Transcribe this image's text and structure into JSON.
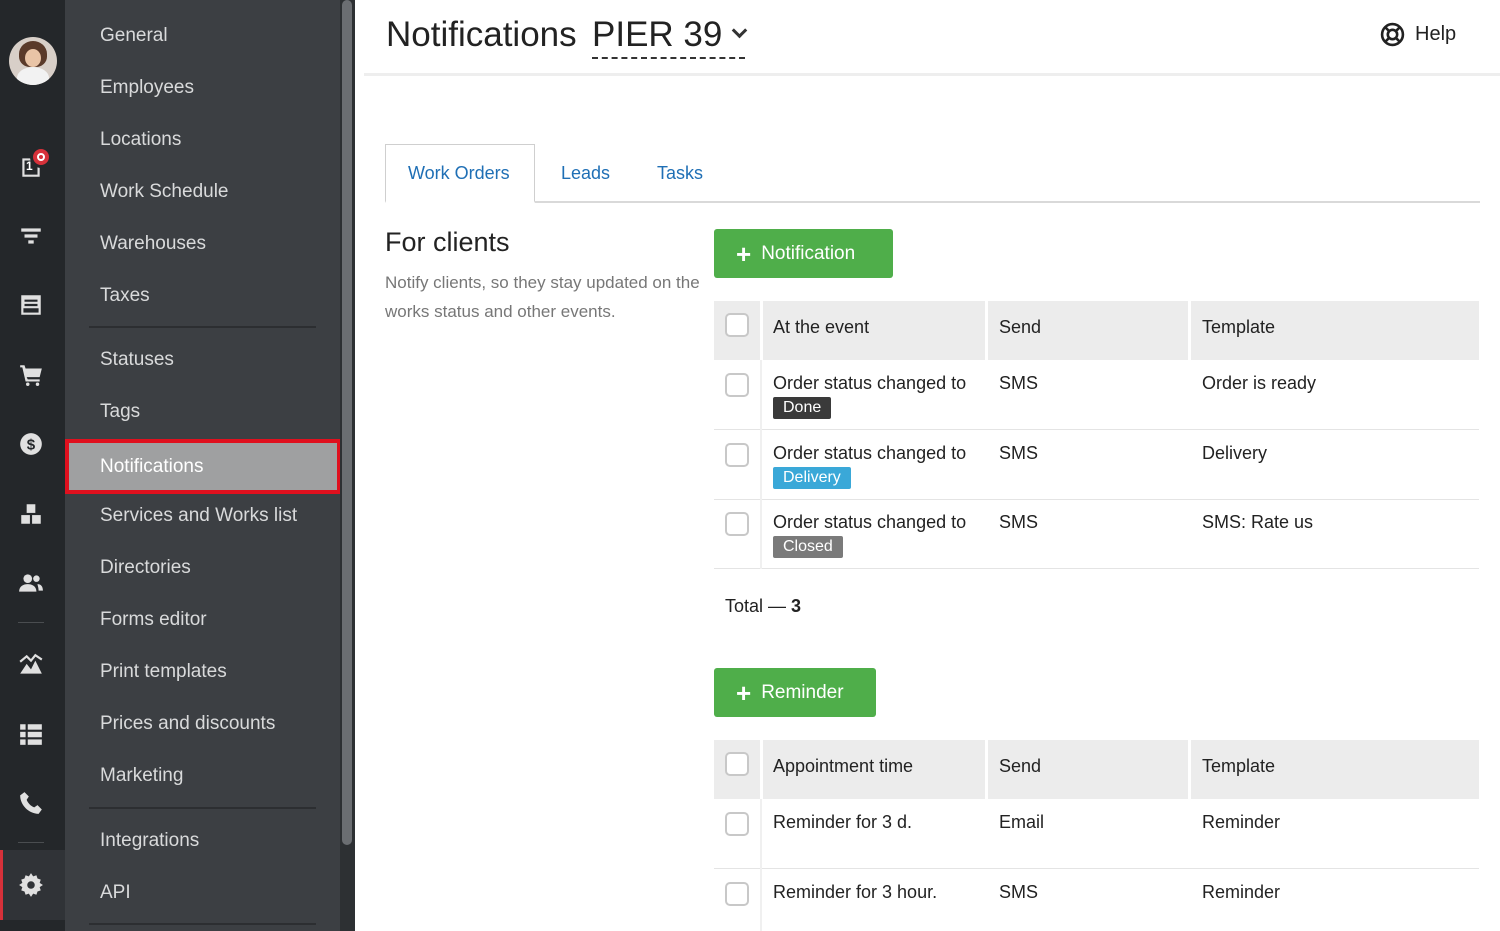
{
  "rail": {
    "notification_count": "1",
    "icons": [
      "avatar",
      "calendar-icon",
      "filter-icon",
      "orders-icon",
      "cart-icon",
      "dollar-icon",
      "warehouse-icon",
      "clients-icon",
      "analytics-icon",
      "list-icon",
      "phone-icon",
      "gear-icon"
    ]
  },
  "sidebar": {
    "items": [
      "General",
      "Employees",
      "Locations",
      "Work Schedule",
      "Warehouses",
      "Taxes",
      "Statuses",
      "Tags",
      "Notifications",
      "Services and Works list",
      "Directories",
      "Forms editor",
      "Print templates",
      "Prices and discounts",
      "Marketing",
      "Integrations",
      "API"
    ],
    "active": "Notifications"
  },
  "header": {
    "title": "Notifications",
    "location": "PIER 39",
    "help": "Help"
  },
  "tabs": [
    "Work Orders",
    "Leads",
    "Tasks"
  ],
  "for_clients": {
    "title": "For clients",
    "description": "Notify clients, so they stay updated on the works status and other events."
  },
  "notifications": {
    "add_button": "Notification",
    "columns": [
      "At the event",
      "Send",
      "Template"
    ],
    "rows": [
      {
        "event": "Order status changed to",
        "status": "Done",
        "status_color": "#3a3a3a",
        "send": "SMS",
        "template": "Order is ready"
      },
      {
        "event": "Order status changed to",
        "status": "Delivery",
        "status_color": "#3aa8d8",
        "send": "SMS",
        "template": "Delivery"
      },
      {
        "event": "Order status changed to",
        "status": "Closed",
        "status_color": "#7a7a7a",
        "send": "SMS",
        "template": "SMS: Rate us"
      }
    ],
    "total_label": "Total —",
    "total_value": "3"
  },
  "reminders": {
    "add_button": "Reminder",
    "columns": [
      "Appointment time",
      "Send",
      "Template"
    ],
    "rows": [
      {
        "time": "Reminder for 3 d.",
        "send": "Email",
        "template": "Reminder"
      },
      {
        "time": "Reminder for 3 hour.",
        "send": "SMS",
        "template": "Reminder"
      }
    ]
  },
  "colors": {
    "accent_green": "#4fae4a",
    "link_blue": "#1f6fb5",
    "active_outline": "#e0101e"
  }
}
